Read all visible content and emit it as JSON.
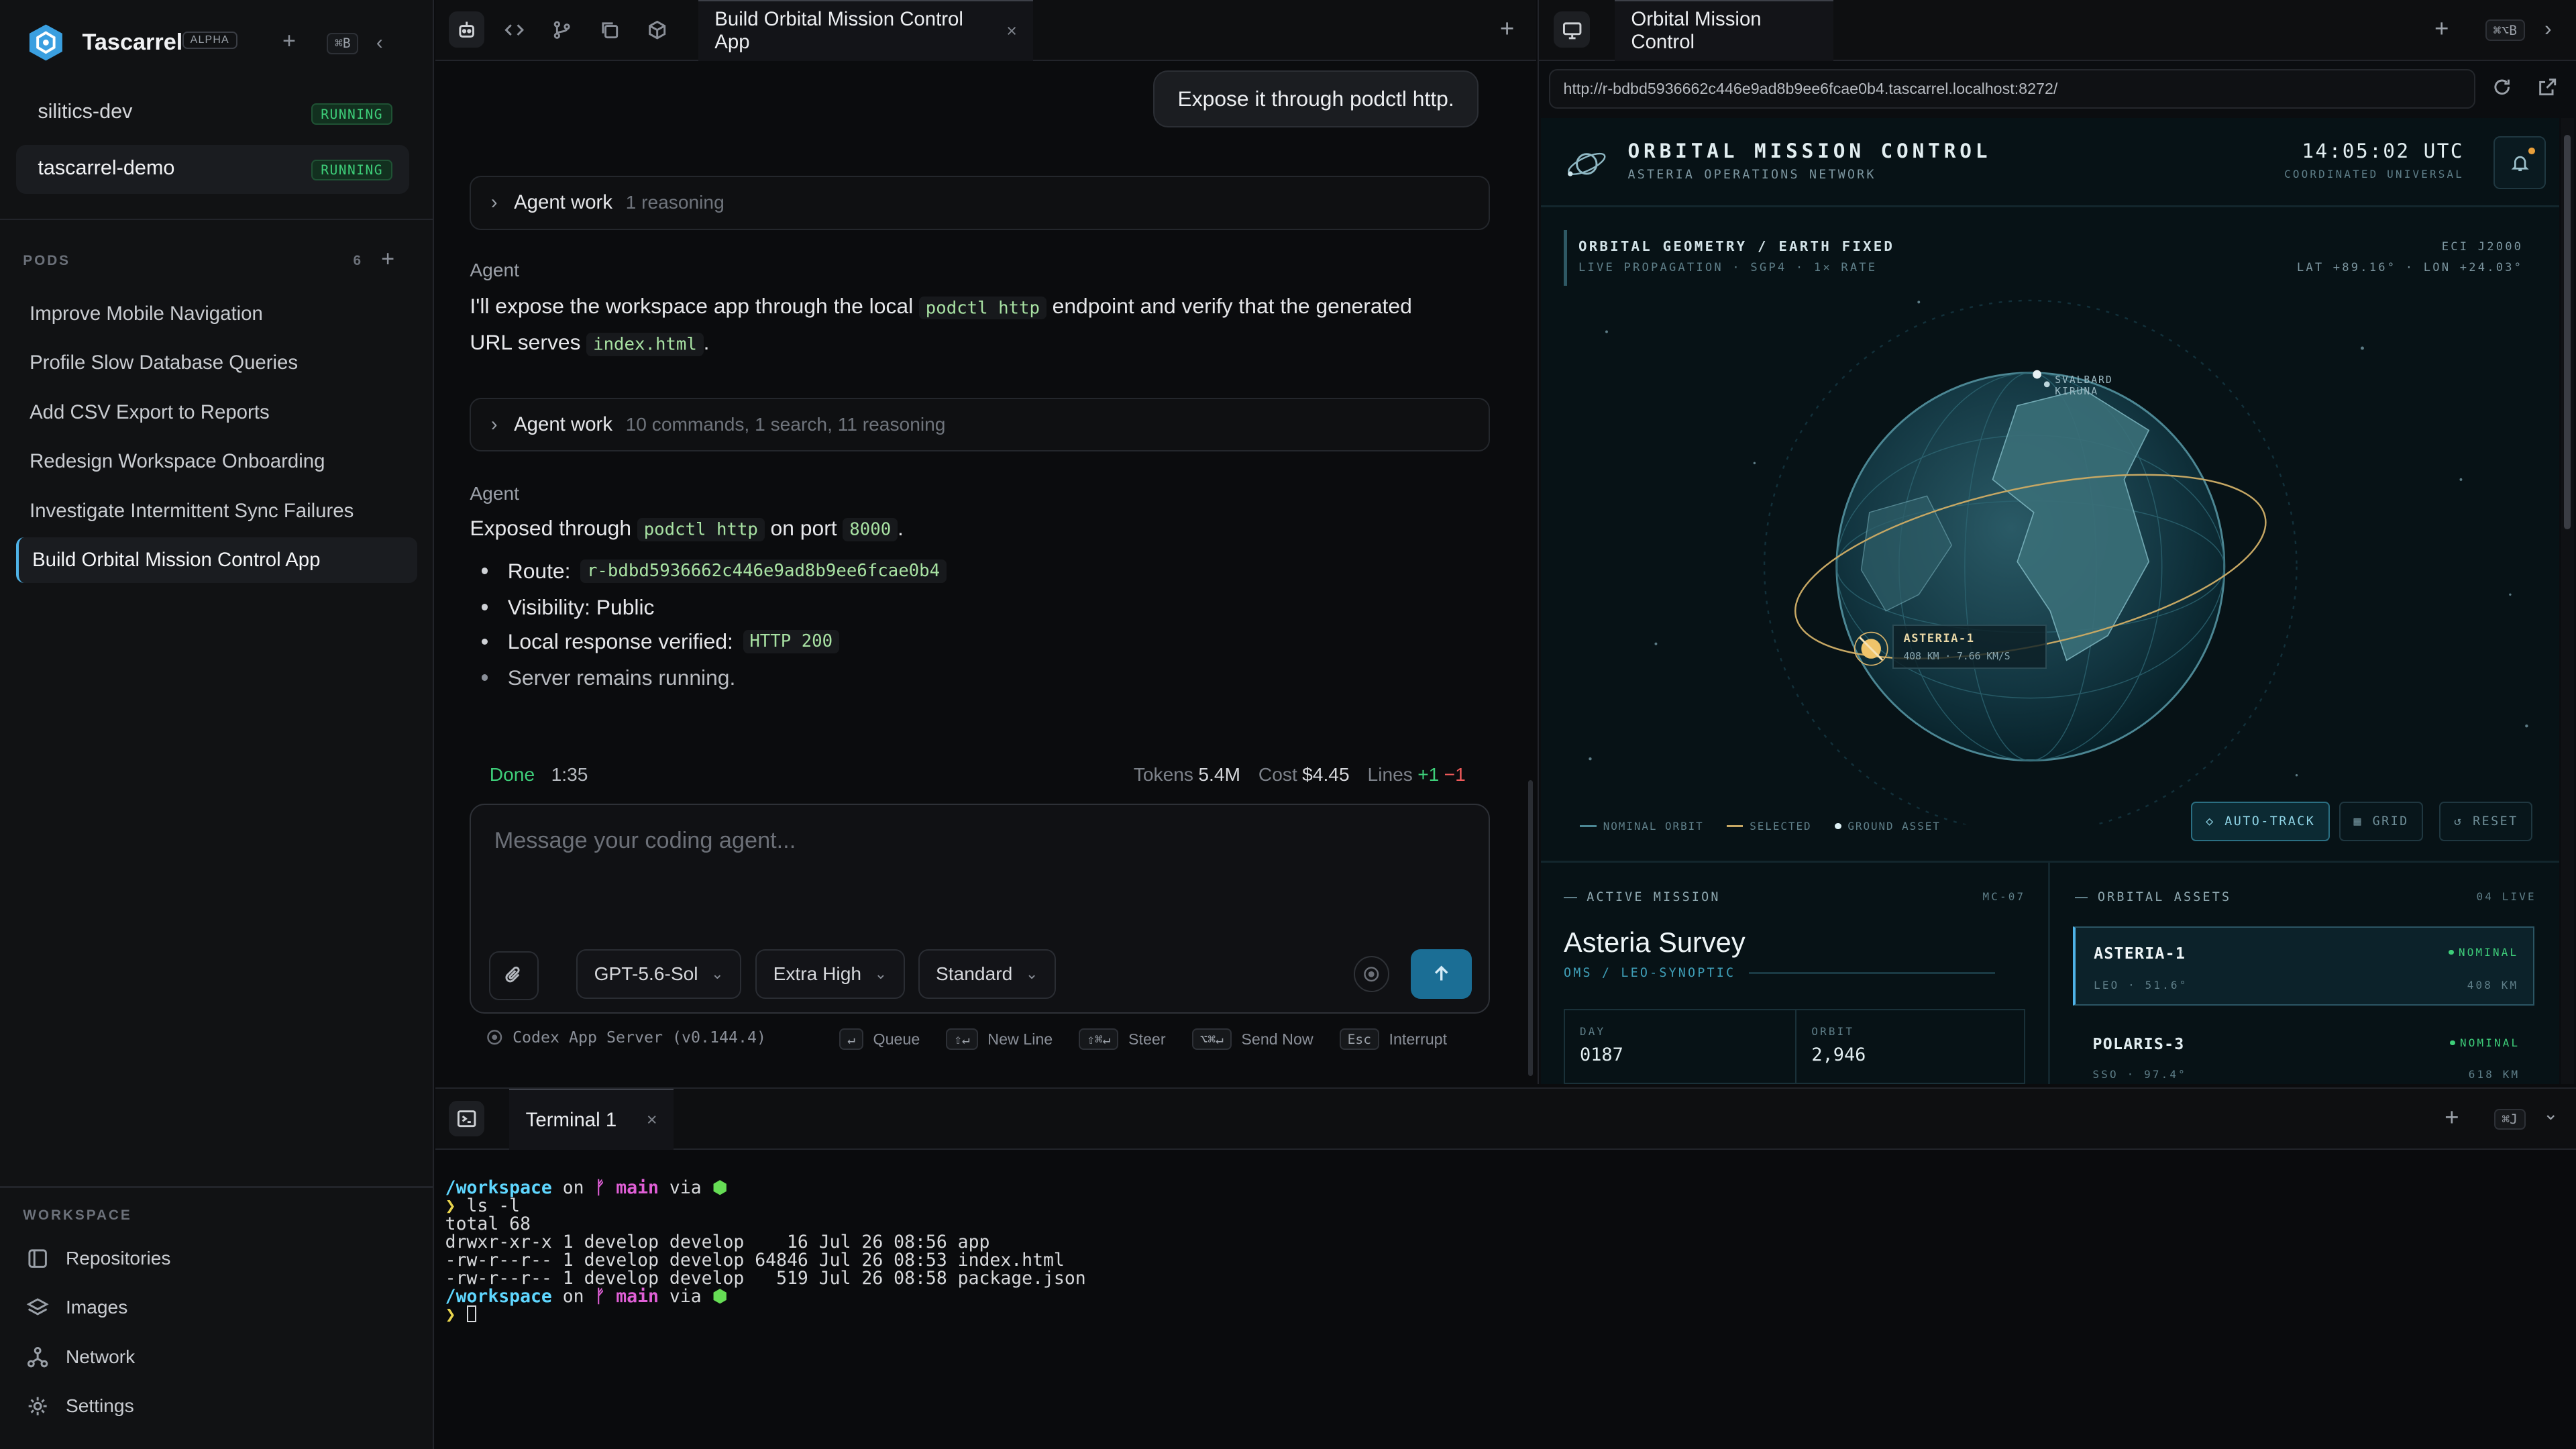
{
  "sidebar": {
    "brand": "Tascarrel",
    "alpha": "ALPHA",
    "shortcut": "⌘B",
    "pods": [
      {
        "name": "silitics-dev",
        "status": "RUNNING"
      },
      {
        "name": "tascarrel-demo",
        "status": "RUNNING"
      }
    ],
    "pods_label": "PODS",
    "pods_count": "6",
    "tasks": [
      "Improve Mobile Navigation",
      "Profile Slow Database Queries",
      "Add CSV Export to Reports",
      "Redesign Workspace Onboarding",
      "Investigate Intermittent Sync Failures",
      "Build Orbital Mission Control App"
    ],
    "active_task_index": 5,
    "workspace_label": "WORKSPACE",
    "workspace_items": [
      {
        "label": "Repositories",
        "icon": "repo-icon"
      },
      {
        "label": "Images",
        "icon": "layers-icon"
      },
      {
        "label": "Network",
        "icon": "network-icon"
      },
      {
        "label": "Settings",
        "icon": "gear-icon"
      }
    ]
  },
  "chat": {
    "tab_title": "Build Orbital Mission Control App",
    "user_message": "Expose it through podctl http.",
    "work1": {
      "label": "Agent work",
      "detail": "1 reasoning"
    },
    "agent_label": "Agent",
    "msg1_a": "I'll expose the workspace app through the local",
    "msg1_code1": "podctl http",
    "msg1_b": "endpoint and verify that the generated",
    "msg1_c": "URL serves",
    "msg1_code2": "index.html",
    "msg1_d": ".",
    "work2": {
      "label": "Agent work",
      "detail": "10 commands, 1 search, 11 reasoning"
    },
    "msg2_a": "Exposed through",
    "msg2_code1": "podctl http",
    "msg2_b": "on port",
    "msg2_code2": "8000",
    "msg2_c": ".",
    "bullets": {
      "route_label": "Route:",
      "route_value": "r-bdbd5936662c446e9ad8b9ee6fcae0b4",
      "visibility": "Visibility: Public",
      "verified_label": "Local response verified:",
      "verified_value": "HTTP 200",
      "server": "Server remains running."
    },
    "status": {
      "done": "Done",
      "time": "1:35",
      "tokens_label": "Tokens",
      "tokens_value": "5.4M",
      "cost_label": "Cost",
      "cost_value": "$4.45",
      "lines_label": "Lines",
      "lines_added": "+1",
      "lines_removed": "−1"
    },
    "composer": {
      "placeholder": "Message your coding agent...",
      "model": "GPT-5.6-Sol",
      "effort": "Extra High",
      "mode": "Standard"
    },
    "footer": {
      "server": "Codex App Server (v0.144.4)",
      "queue_key": "↵",
      "queue": "Queue",
      "newline_key": "⇧↵",
      "newline": "New Line",
      "steer_key": "⇧⌘↵",
      "steer": "Steer",
      "send_key": "⌥⌘↵",
      "send": "Send Now",
      "esc_key": "Esc",
      "interrupt": "Interrupt"
    }
  },
  "browser": {
    "tab_title": "Orbital Mission Control",
    "shortcut": "⌘⌥B",
    "url": "http://r-bdbd5936662c446e9ad8b9ee6fcae0b4.tascarrel.localhost:8272/",
    "site": {
      "title": "ORBITAL MISSION CONTROL",
      "subtitle": "ASTERIA OPERATIONS NETWORK",
      "time": "14:05:02 UTC",
      "time_sub": "COORDINATED UNIVERSAL",
      "geo_title": "ORBITAL GEOMETRY / EARTH FIXED",
      "geo_sub": "LIVE PROPAGATION · SGP4 · 1× RATE",
      "frame": "ECI J2000",
      "latlon": "LAT +89.16° · LON +24.03°",
      "svalbard": "SVALBARD",
      "kiruna": "KIRUNA",
      "sat_name": "ASTERIA-1",
      "sat_info": "408 KM · 7.66 KM/S",
      "legend": [
        "NOMINAL ORBIT",
        "SELECTED",
        "GROUND ASSET"
      ],
      "controls": [
        "AUTO-TRACK",
        "GRID",
        "RESET"
      ],
      "mission": {
        "label": "ACTIVE MISSION",
        "code": "MC-07",
        "name": "Asteria Survey",
        "sub": "OMS / LEO-SYNOPTIC",
        "day_label": "DAY",
        "day_value": "0187",
        "orbit_label": "ORBIT",
        "orbit_value": "2,946"
      },
      "assets": {
        "label": "ORBITAL ASSETS",
        "count": "04 LIVE",
        "items": [
          {
            "name": "ASTERIA-1",
            "status": "NOMINAL",
            "detail": "LEO · 51.6°",
            "alt": "408 KM"
          },
          {
            "name": "POLARIS-3",
            "status": "NOMINAL",
            "detail": "SSO · 97.4°",
            "alt": "618 KM"
          }
        ]
      }
    }
  },
  "terminal": {
    "tab": "Terminal 1",
    "shortcut": "⌘J",
    "prompt_path": "/workspace",
    "prompt_on": "on",
    "prompt_branch": "ᚠ main",
    "prompt_via": "via",
    "command": "ls -l",
    "output": [
      "total 68",
      "drwxr-xr-x 1 develop develop    16 Jul 26 08:56 app",
      "-rw-r--r-- 1 develop develop 64846 Jul 26 08:53 index.html",
      "-rw-r--r-- 1 develop develop   519 Jul 26 08:58 package.json"
    ]
  },
  "colors": {
    "accent": "#4fb3e8",
    "running": "#3ecf7a",
    "send": "#1b6e95"
  }
}
